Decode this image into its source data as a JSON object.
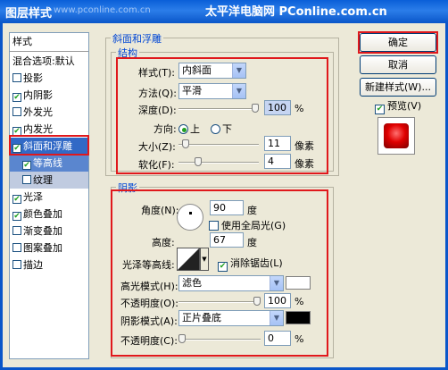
{
  "window": {
    "title": "图层样式",
    "watermark": "太平洋电脑网 PConline.com.cn",
    "watermark_faded": "www.pconline.com.cn"
  },
  "sidebar": {
    "items": [
      {
        "label": "样式",
        "check": false,
        "has_check": false
      },
      {
        "label": "混合选项:默认",
        "check": false,
        "has_check": false
      },
      {
        "label": "投影",
        "check": false,
        "has_check": true
      },
      {
        "label": "内阴影",
        "check": true,
        "has_check": true
      },
      {
        "label": "外发光",
        "check": false,
        "has_check": true
      },
      {
        "label": "内发光",
        "check": true,
        "has_check": true
      },
      {
        "label": "斜面和浮雕",
        "check": true,
        "has_check": true
      },
      {
        "label": "等高线",
        "check": true,
        "has_check": true
      },
      {
        "label": "纹理",
        "check": false,
        "has_check": true
      },
      {
        "label": "光泽",
        "check": true,
        "has_check": true
      },
      {
        "label": "颜色叠加",
        "check": true,
        "has_check": true
      },
      {
        "label": "渐变叠加",
        "check": false,
        "has_check": true
      },
      {
        "label": "图案叠加",
        "check": false,
        "has_check": true
      },
      {
        "label": "描边",
        "check": false,
        "has_check": true
      }
    ],
    "check_mark": "✔"
  },
  "bevel": {
    "group_title": "斜面和浮雕",
    "structure_title": "结构",
    "style_label": "样式(T):",
    "style_value": "内斜面",
    "method_label": "方法(Q):",
    "method_value": "平滑",
    "depth_label": "深度(D):",
    "depth_value": "100",
    "depth_unit": "%",
    "direction_label": "方向:",
    "dir_up": "上",
    "dir_down": "下",
    "size_label": "大小(Z):",
    "size_value": "11",
    "size_unit": "像素",
    "soften_label": "软化(F):",
    "soften_value": "4",
    "soften_unit": "像素"
  },
  "shading": {
    "title": "阴影",
    "angle_label": "角度(N):",
    "angle_value": "90",
    "angle_unit": "度",
    "global_light": "使用全局光(G)",
    "altitude_label": "高度:",
    "altitude_value": "67",
    "altitude_unit": "度",
    "gloss_label": "光泽等高线:",
    "anti_alias": "消除锯齿(L)",
    "highlight_label": "高光模式(H):",
    "highlight_value": "滤色",
    "highlight_color": "#ffffff",
    "opacity_label": "不透明度(O):",
    "opacity_value": "100",
    "opacity_unit": "%",
    "shadow_label": "阴影模式(A):",
    "shadow_value": "正片叠底",
    "shadow_color": "#000000",
    "opacity2_label": "不透明度(C):",
    "opacity2_value": "0",
    "opacity2_unit": "%"
  },
  "buttons": {
    "ok": "确定",
    "cancel": "取消",
    "new_style": "新建样式(W)...",
    "preview": "预览(V)"
  }
}
